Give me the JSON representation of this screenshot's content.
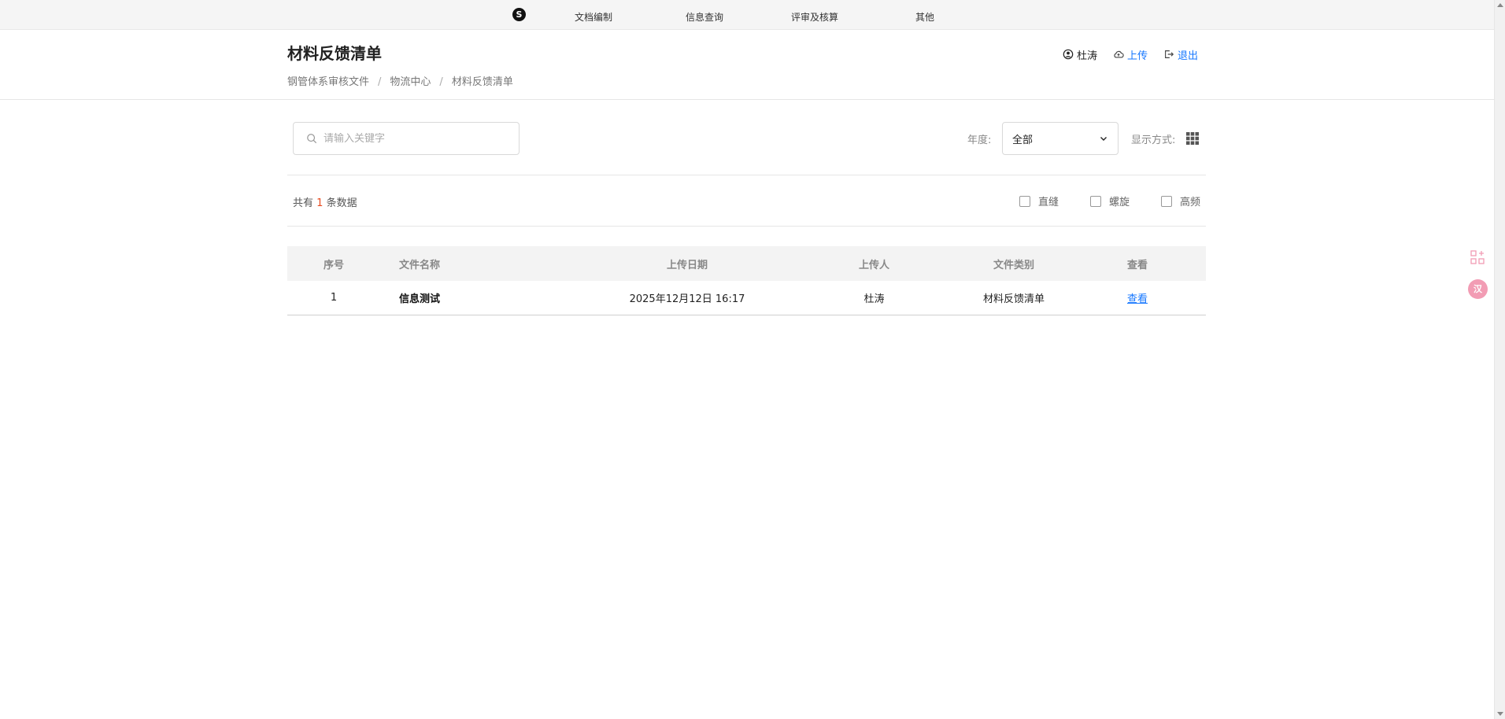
{
  "nav": {
    "logo_glyph": "S",
    "items": [
      {
        "label": "文档编制"
      },
      {
        "label": "信息查询"
      },
      {
        "label": "评审及核算"
      },
      {
        "label": "其他"
      }
    ]
  },
  "header": {
    "title": "材料反馈清单",
    "breadcrumb": [
      "钢管体系审核文件",
      "物流中心",
      "材料反馈清单"
    ],
    "separator": "/",
    "user": {
      "name": "杜涛",
      "upload_label": "上传",
      "logout_label": "退出"
    }
  },
  "filters": {
    "search_placeholder": "请输入关键字",
    "search_value": "",
    "year_label": "年度:",
    "year_value": "全部",
    "display_label": "显示方式:"
  },
  "summary": {
    "prefix": "共有",
    "count": "1",
    "suffix": "条数据",
    "checkboxes": [
      {
        "label": "直缝",
        "checked": false
      },
      {
        "label": "螺旋",
        "checked": false
      },
      {
        "label": "高频",
        "checked": false
      }
    ]
  },
  "table": {
    "headers": [
      "序号",
      "文件名称",
      "上传日期",
      "上传人",
      "文件类别",
      "查看"
    ],
    "rows": [
      {
        "index": "1",
        "name": "信息测试",
        "date": "2025年12月12日 16:17",
        "uploader": "杜涛",
        "category": "材料反馈清单",
        "view": "查看"
      }
    ]
  },
  "side": {
    "translate_glyph": "汉"
  },
  "colors": {
    "accent": "#1677ff",
    "count_highlight": "#e8491d",
    "nav_bg": "#f5f5f5",
    "table_header_bg": "#f3f3f3",
    "side_badge": "#f29cb4"
  }
}
